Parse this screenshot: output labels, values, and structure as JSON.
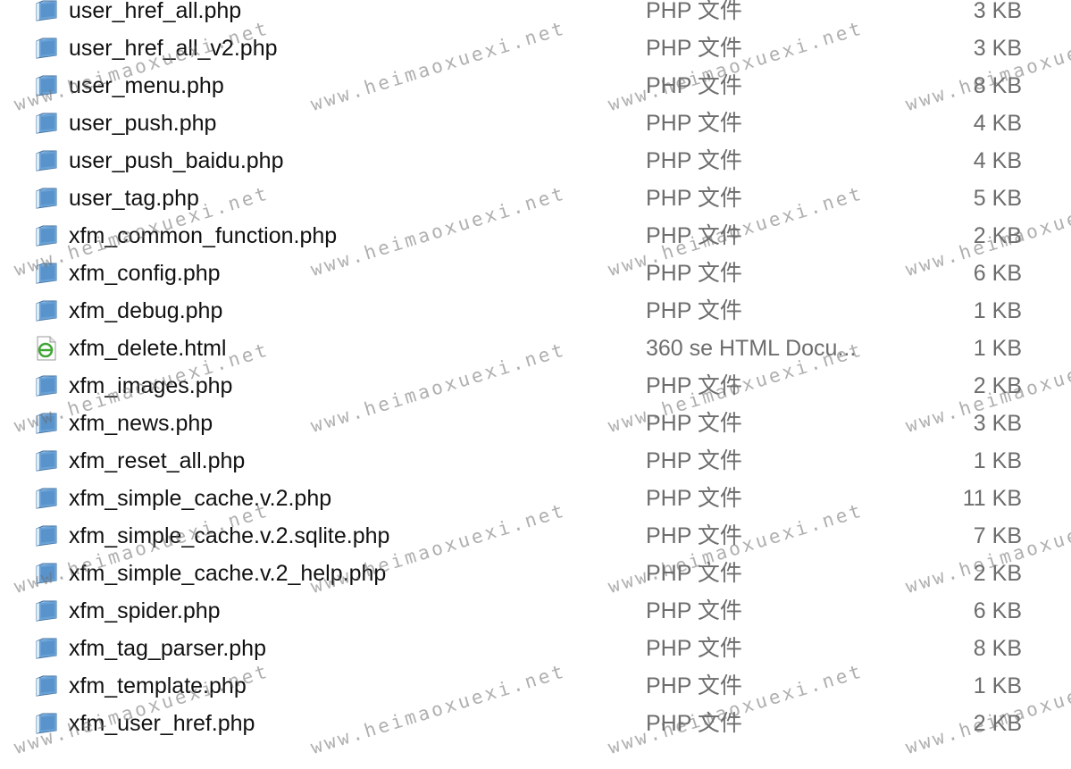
{
  "files": [
    {
      "name": "user_href_all.php",
      "type": "PHP 文件",
      "size": "3 KB",
      "icon": "php-file-icon"
    },
    {
      "name": "user_href_all_v2.php",
      "type": "PHP 文件",
      "size": "3 KB",
      "icon": "php-file-icon"
    },
    {
      "name": "user_menu.php",
      "type": "PHP 文件",
      "size": "8 KB",
      "icon": "php-file-icon"
    },
    {
      "name": "user_push.php",
      "type": "PHP 文件",
      "size": "4 KB",
      "icon": "php-file-icon"
    },
    {
      "name": "user_push_baidu.php",
      "type": "PHP 文件",
      "size": "4 KB",
      "icon": "php-file-icon"
    },
    {
      "name": "user_tag.php",
      "type": "PHP 文件",
      "size": "5 KB",
      "icon": "php-file-icon"
    },
    {
      "name": "xfm_common_function.php",
      "type": "PHP 文件",
      "size": "2 KB",
      "icon": "php-file-icon"
    },
    {
      "name": "xfm_config.php",
      "type": "PHP 文件",
      "size": "6 KB",
      "icon": "php-file-icon"
    },
    {
      "name": "xfm_debug.php",
      "type": "PHP 文件",
      "size": "1 KB",
      "icon": "php-file-icon"
    },
    {
      "name": "xfm_delete.html",
      "type": "360 se HTML Docu...",
      "size": "1 KB",
      "icon": "html-file-icon"
    },
    {
      "name": "xfm_images.php",
      "type": "PHP 文件",
      "size": "2 KB",
      "icon": "php-file-icon"
    },
    {
      "name": "xfm_news.php",
      "type": "PHP 文件",
      "size": "3 KB",
      "icon": "php-file-icon"
    },
    {
      "name": "xfm_reset_all.php",
      "type": "PHP 文件",
      "size": "1 KB",
      "icon": "php-file-icon"
    },
    {
      "name": "xfm_simple_cache.v.2.php",
      "type": "PHP 文件",
      "size": "11 KB",
      "icon": "php-file-icon"
    },
    {
      "name": "xfm_simple_cache.v.2.sqlite.php",
      "type": "PHP 文件",
      "size": "7 KB",
      "icon": "php-file-icon"
    },
    {
      "name": "xfm_simple_cache.v.2_help.php",
      "type": "PHP 文件",
      "size": "2 KB",
      "icon": "php-file-icon"
    },
    {
      "name": "xfm_spider.php",
      "type": "PHP 文件",
      "size": "6 KB",
      "icon": "php-file-icon"
    },
    {
      "name": "xfm_tag_parser.php",
      "type": "PHP 文件",
      "size": "8 KB",
      "icon": "php-file-icon"
    },
    {
      "name": "xfm_template.php",
      "type": "PHP 文件",
      "size": "1 KB",
      "icon": "php-file-icon"
    },
    {
      "name": "xfm_user_href.php",
      "type": "PHP 文件",
      "size": "2 KB",
      "icon": "php-file-icon"
    }
  ],
  "watermark": "www.heimaoxuexi.net",
  "colors": {
    "name_text": "#111111",
    "meta_text": "#6d6d6d",
    "php_icon_blue": "#5b9bd5",
    "html_icon_green": "#3fa535"
  }
}
